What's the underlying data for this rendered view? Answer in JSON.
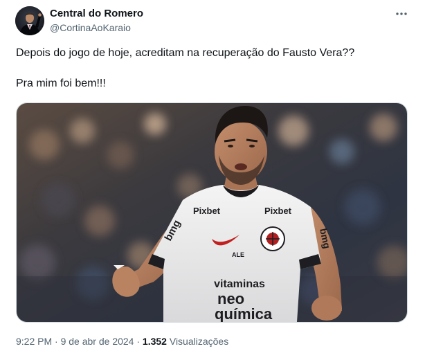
{
  "tweet": {
    "author": {
      "display_name": "Central do Romero",
      "handle": "@CortinaAoKaraio"
    },
    "more_icon": "more-horizontal-icon",
    "text_lines": [
      "Depois do jogo de hoje, acreditam na recuperação do Fausto Vera??",
      "Pra mim foi bem!!!"
    ],
    "media": {
      "shirt_sponsors": {
        "chest_top": "vitaminas",
        "chest_mid": "neo",
        "chest_bottom": "química",
        "shoulder_left": "bmg",
        "shoulder_right": "bmg",
        "collar_left": "Pixbet",
        "collar_right": "Pixbet",
        "sleeve": "ALE"
      }
    },
    "meta": {
      "time": "9:22 PM",
      "separator": "·",
      "date": "9 de abr de 2024",
      "views_count": "1.352",
      "views_label": "Visualizações"
    },
    "colors": {
      "text_primary": "#0f1419",
      "text_secondary": "#536471",
      "border": "#cfd9de"
    }
  }
}
